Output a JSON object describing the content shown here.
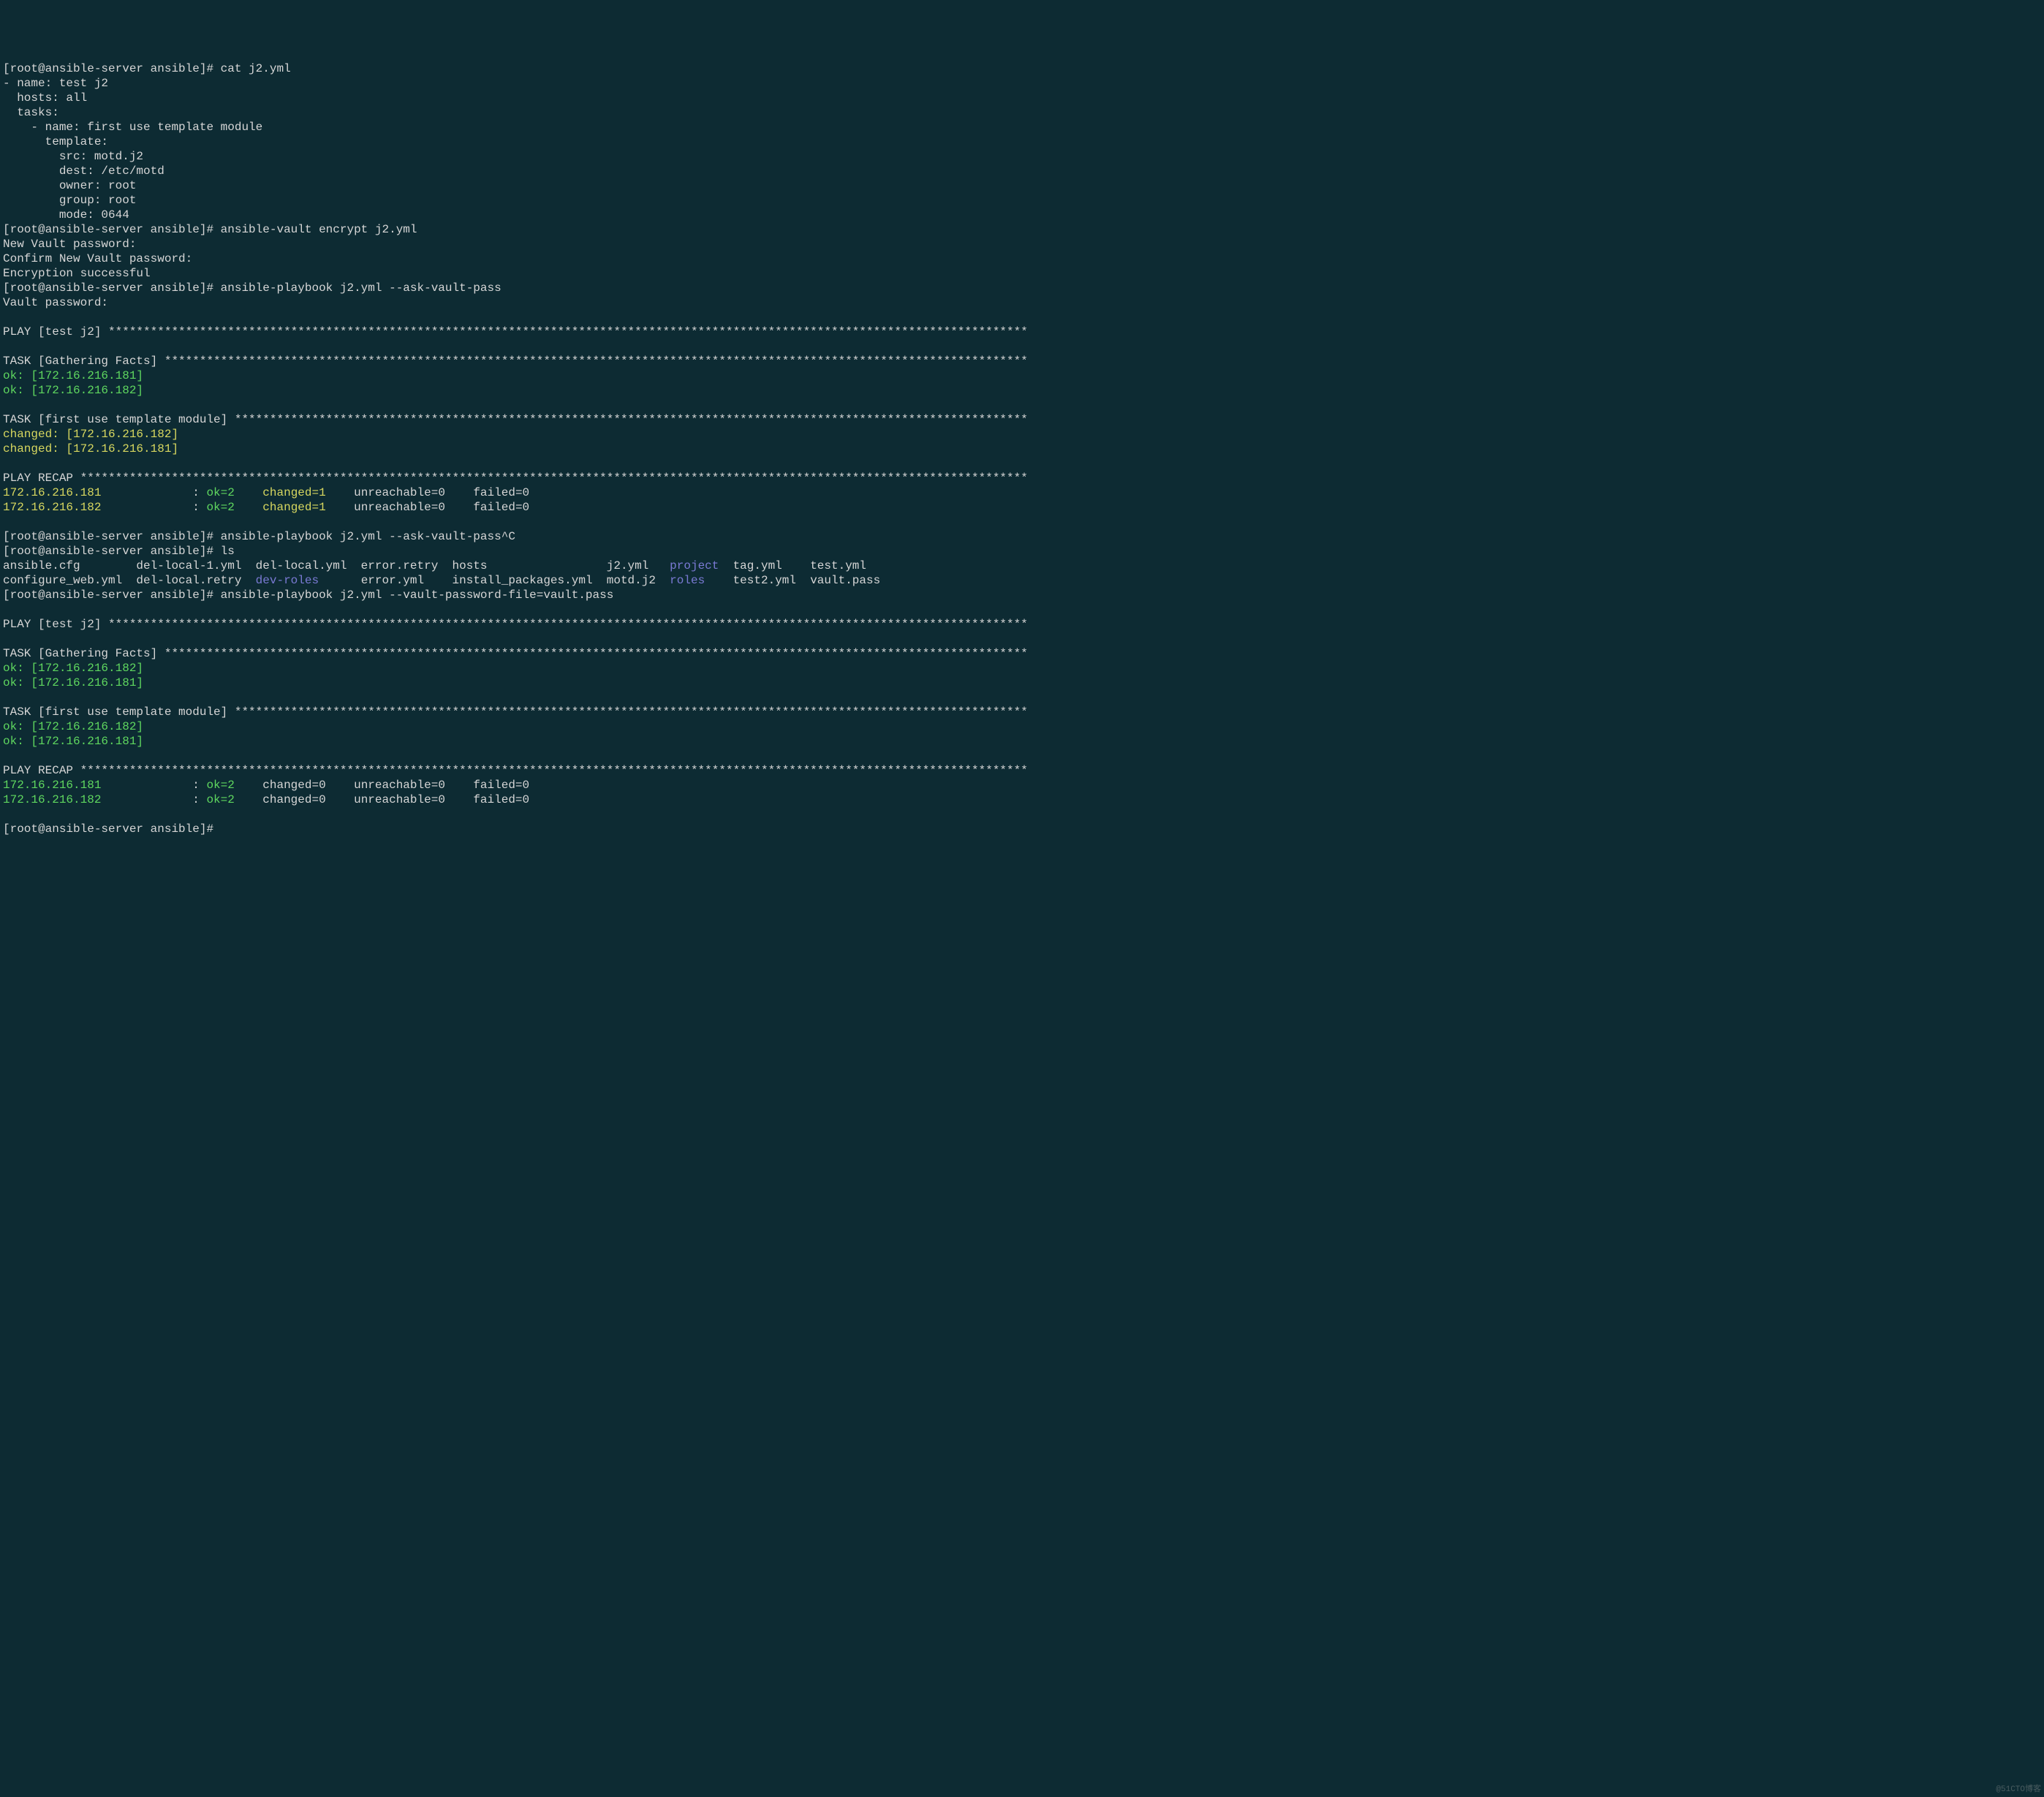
{
  "lines": [
    {
      "segs": [
        {
          "t": "[root@ansible-server ansible]# cat j2.yml",
          "c": "white"
        }
      ]
    },
    {
      "segs": [
        {
          "t": "- name: test j2",
          "c": "white"
        }
      ]
    },
    {
      "segs": [
        {
          "t": "  hosts: all",
          "c": "white"
        }
      ]
    },
    {
      "segs": [
        {
          "t": "  tasks:",
          "c": "white"
        }
      ]
    },
    {
      "segs": [
        {
          "t": "    - name: first use template module",
          "c": "white"
        }
      ]
    },
    {
      "segs": [
        {
          "t": "      template:",
          "c": "white"
        }
      ]
    },
    {
      "segs": [
        {
          "t": "        src: motd.j2",
          "c": "white"
        }
      ]
    },
    {
      "segs": [
        {
          "t": "        dest: /etc/motd",
          "c": "white"
        }
      ]
    },
    {
      "segs": [
        {
          "t": "        owner: root",
          "c": "white"
        }
      ]
    },
    {
      "segs": [
        {
          "t": "        group: root",
          "c": "white"
        }
      ]
    },
    {
      "segs": [
        {
          "t": "        mode: 0644",
          "c": "white"
        }
      ]
    },
    {
      "segs": [
        {
          "t": "[root@ansible-server ansible]# ansible-vault encrypt j2.yml",
          "c": "white"
        }
      ]
    },
    {
      "segs": [
        {
          "t": "New Vault password: ",
          "c": "white"
        }
      ]
    },
    {
      "segs": [
        {
          "t": "Confirm New Vault password: ",
          "c": "white"
        }
      ]
    },
    {
      "segs": [
        {
          "t": "Encryption successful",
          "c": "white"
        }
      ]
    },
    {
      "segs": [
        {
          "t": "[root@ansible-server ansible]# ansible-playbook j2.yml --ask-vault-pass",
          "c": "white"
        }
      ]
    },
    {
      "segs": [
        {
          "t": "Vault password: ",
          "c": "white"
        }
      ]
    },
    {
      "segs": [
        {
          "t": "",
          "c": "white"
        }
      ]
    },
    {
      "segs": [
        {
          "t": "PLAY [test j2] ***********************************************************************************************************************************",
          "c": "white"
        }
      ]
    },
    {
      "segs": [
        {
          "t": "",
          "c": "white"
        }
      ]
    },
    {
      "segs": [
        {
          "t": "TASK [Gathering Facts] ***************************************************************************************************************************",
          "c": "white"
        }
      ]
    },
    {
      "segs": [
        {
          "t": "ok: [172.16.216.181]",
          "c": "green"
        }
      ]
    },
    {
      "segs": [
        {
          "t": "ok: [172.16.216.182]",
          "c": "green"
        }
      ]
    },
    {
      "segs": [
        {
          "t": "",
          "c": "white"
        }
      ]
    },
    {
      "segs": [
        {
          "t": "TASK [first use template module] *****************************************************************************************************************",
          "c": "white"
        }
      ]
    },
    {
      "segs": [
        {
          "t": "changed: [172.16.216.182]",
          "c": "yellow"
        }
      ]
    },
    {
      "segs": [
        {
          "t": "changed: [172.16.216.181]",
          "c": "yellow"
        }
      ]
    },
    {
      "segs": [
        {
          "t": "",
          "c": "white"
        }
      ]
    },
    {
      "segs": [
        {
          "t": "PLAY RECAP ***************************************************************************************************************************************",
          "c": "white"
        }
      ]
    },
    {
      "segs": [
        {
          "t": "172.16.216.181",
          "c": "yellow"
        },
        {
          "t": "             : ",
          "c": "white"
        },
        {
          "t": "ok=2   ",
          "c": "green"
        },
        {
          "t": " ",
          "c": "white"
        },
        {
          "t": "changed=1   ",
          "c": "yellow"
        },
        {
          "t": " unreachable=0    failed=0   ",
          "c": "white"
        }
      ]
    },
    {
      "segs": [
        {
          "t": "172.16.216.182",
          "c": "yellow"
        },
        {
          "t": "             : ",
          "c": "white"
        },
        {
          "t": "ok=2   ",
          "c": "green"
        },
        {
          "t": " ",
          "c": "white"
        },
        {
          "t": "changed=1   ",
          "c": "yellow"
        },
        {
          "t": " unreachable=0    failed=0   ",
          "c": "white"
        }
      ]
    },
    {
      "segs": [
        {
          "t": "",
          "c": "white"
        }
      ]
    },
    {
      "segs": [
        {
          "t": "[root@ansible-server ansible]# ansible-playbook j2.yml --ask-vault-pass^C",
          "c": "white"
        }
      ]
    },
    {
      "segs": [
        {
          "t": "[root@ansible-server ansible]# ls",
          "c": "white"
        }
      ]
    },
    {
      "segs": [
        {
          "t": "ansible.cfg        del-local-1.yml  del-local.yml  error.retry  hosts                 j2.yml   ",
          "c": "white"
        },
        {
          "t": "project",
          "c": "purple"
        },
        {
          "t": "  tag.yml    test.yml",
          "c": "white"
        }
      ]
    },
    {
      "segs": [
        {
          "t": "configure_web.yml  del-local.retry  ",
          "c": "white"
        },
        {
          "t": "dev-roles",
          "c": "purple"
        },
        {
          "t": "      error.yml    install_packages.yml  motd.j2  ",
          "c": "white"
        },
        {
          "t": "roles",
          "c": "purple"
        },
        {
          "t": "    test2.yml  vault.pass",
          "c": "white"
        }
      ]
    },
    {
      "segs": [
        {
          "t": "[root@ansible-server ansible]# ansible-playbook j2.yml --vault-password-file=vault.pass",
          "c": "white"
        }
      ]
    },
    {
      "segs": [
        {
          "t": "",
          "c": "white"
        }
      ]
    },
    {
      "segs": [
        {
          "t": "PLAY [test j2] ***********************************************************************************************************************************",
          "c": "white"
        }
      ]
    },
    {
      "segs": [
        {
          "t": "",
          "c": "white"
        }
      ]
    },
    {
      "segs": [
        {
          "t": "TASK [Gathering Facts] ***************************************************************************************************************************",
          "c": "white"
        }
      ]
    },
    {
      "segs": [
        {
          "t": "ok: [172.16.216.182]",
          "c": "green"
        }
      ]
    },
    {
      "segs": [
        {
          "t": "ok: [172.16.216.181]",
          "c": "green"
        }
      ]
    },
    {
      "segs": [
        {
          "t": "",
          "c": "white"
        }
      ]
    },
    {
      "segs": [
        {
          "t": "TASK [first use template module] *****************************************************************************************************************",
          "c": "white"
        }
      ]
    },
    {
      "segs": [
        {
          "t": "ok: [172.16.216.182]",
          "c": "green"
        }
      ]
    },
    {
      "segs": [
        {
          "t": "ok: [172.16.216.181]",
          "c": "green"
        }
      ]
    },
    {
      "segs": [
        {
          "t": "",
          "c": "white"
        }
      ]
    },
    {
      "segs": [
        {
          "t": "PLAY RECAP ***************************************************************************************************************************************",
          "c": "white"
        }
      ]
    },
    {
      "segs": [
        {
          "t": "172.16.216.181",
          "c": "green"
        },
        {
          "t": "             : ",
          "c": "white"
        },
        {
          "t": "ok=2   ",
          "c": "green"
        },
        {
          "t": " changed=0    unreachable=0    failed=0   ",
          "c": "white"
        }
      ]
    },
    {
      "segs": [
        {
          "t": "172.16.216.182",
          "c": "green"
        },
        {
          "t": "             : ",
          "c": "white"
        },
        {
          "t": "ok=2   ",
          "c": "green"
        },
        {
          "t": " changed=0    unreachable=0    failed=0   ",
          "c": "white"
        }
      ]
    },
    {
      "segs": [
        {
          "t": "",
          "c": "white"
        }
      ]
    },
    {
      "segs": [
        {
          "t": "[root@ansible-server ansible]# ",
          "c": "white"
        }
      ]
    }
  ],
  "watermark": "@51CTO博客"
}
